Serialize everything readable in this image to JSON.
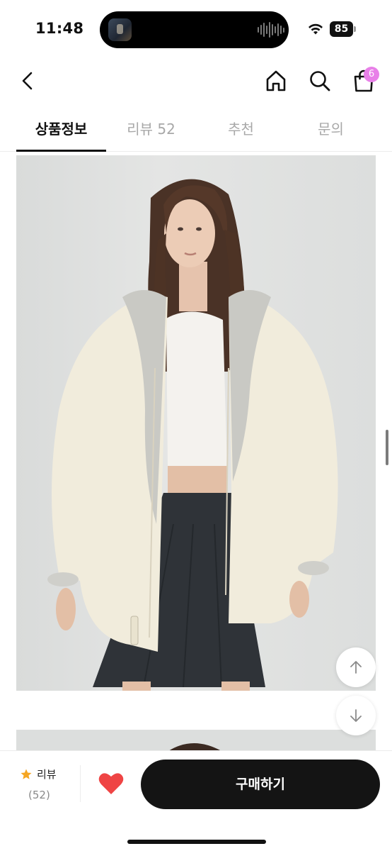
{
  "status_bar": {
    "time": "11:48",
    "battery": "85",
    "icons": [
      "wifi-icon",
      "battery-icon",
      "audio-wave-icon"
    ]
  },
  "header": {
    "icons": [
      "chevron-left-icon",
      "home-icon",
      "search-icon",
      "shopping-bag-icon"
    ],
    "cart_badge": "6"
  },
  "tabs": [
    {
      "label": "상품정보"
    },
    {
      "label": "리뷰 52"
    },
    {
      "label": "추천"
    },
    {
      "label": "문의"
    }
  ],
  "colors": {
    "accent_badge": "#e880e8",
    "heart": "#ef4444",
    "star": "#f5a623",
    "buy_button": "#141414"
  },
  "bottom_bar": {
    "review_label": "리뷰",
    "review_count": "(52)",
    "buy_label": "구매하기",
    "icons": [
      "star-icon",
      "heart-icon"
    ]
  },
  "floating": {
    "icons": [
      "arrow-up-icon",
      "arrow-down-icon"
    ]
  }
}
